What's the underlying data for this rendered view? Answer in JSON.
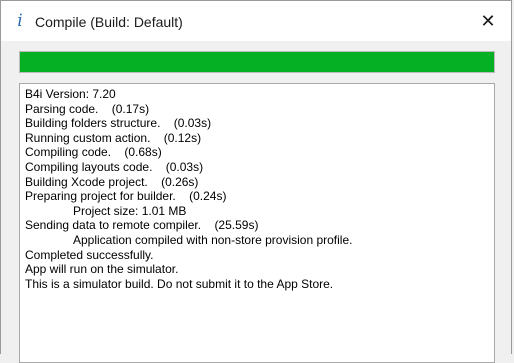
{
  "window": {
    "icon": "info-i-icon",
    "title": "Compile (Build: Default)",
    "close_glyph": "✕"
  },
  "progress": {
    "value": 1.0,
    "color": "#06b025"
  },
  "log": [
    {
      "text": "B4i Version: 7.20",
      "indent": false
    },
    {
      "text": "Parsing code.    (0.17s)",
      "indent": false
    },
    {
      "text": "Building folders structure.    (0.03s)",
      "indent": false
    },
    {
      "text": "Running custom action.    (0.12s)",
      "indent": false
    },
    {
      "text": "Compiling code.    (0.68s)",
      "indent": false
    },
    {
      "text": "Compiling layouts code.    (0.03s)",
      "indent": false
    },
    {
      "text": "Building Xcode project.    (0.26s)",
      "indent": false
    },
    {
      "text": "Preparing project for builder.    (0.24s)",
      "indent": false
    },
    {
      "text": "Project size: 1.01 MB",
      "indent": true
    },
    {
      "text": "Sending data to remote compiler.    (25.59s)",
      "indent": false
    },
    {
      "text": "Application compiled with non-store provision profile.",
      "indent": true
    },
    {
      "text": "Completed successfully.",
      "indent": false
    },
    {
      "text": "App will run on the simulator.",
      "indent": false
    },
    {
      "text": "This is a simulator build. Do not submit it to the App Store.",
      "indent": false
    }
  ]
}
